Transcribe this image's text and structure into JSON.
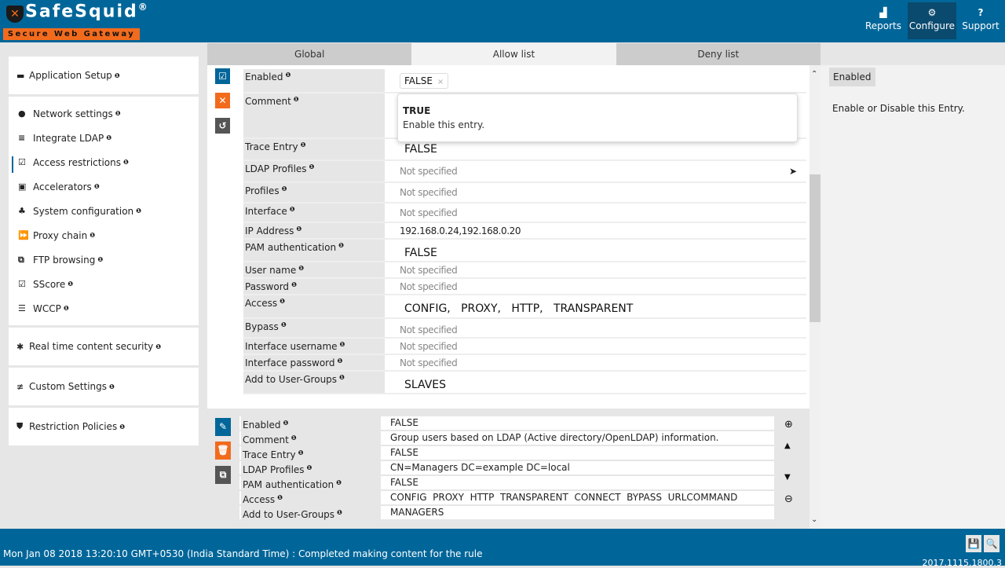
{
  "brand": {
    "name": "SafeSquid",
    "reg": "®",
    "tagline": "Secure Web Gateway"
  },
  "nav": [
    {
      "label": "Reports",
      "icon": "chart-icon"
    },
    {
      "label": "Configure",
      "icon": "cogs-icon",
      "active": true
    },
    {
      "label": "Support",
      "icon": "question-icon"
    }
  ],
  "sidebar": {
    "app_setup": "Application Setup",
    "items": [
      "Network settings",
      "Integrate LDAP",
      "Access restrictions",
      "Accelerators",
      "System configuration",
      "Proxy chain",
      "FTP browsing",
      "SScore",
      "WCCP"
    ],
    "realtime": "Real time content security",
    "custom": "Custom Settings",
    "restriction": "Restriction Policies",
    "info_glyph": "❶"
  },
  "tabs": [
    "Global",
    "Allow list",
    "Deny list"
  ],
  "active_tab": "Allow list",
  "editor": {
    "fields": [
      {
        "label": "Enabled",
        "value": "FALSE"
      },
      {
        "label": "Comment",
        "value": ""
      },
      {
        "label": "Trace Entry",
        "value": "FALSE"
      },
      {
        "label": "LDAP Profiles",
        "value": "Not specified"
      },
      {
        "label": "Profiles",
        "value": "Not specified"
      },
      {
        "label": "Interface",
        "value": "Not specified"
      },
      {
        "label": "IP Address",
        "value": "192.168.0.24,192.168.0.20"
      },
      {
        "label": "PAM authentication",
        "value": "FALSE"
      },
      {
        "label": "User name",
        "value": "Not specified"
      },
      {
        "label": "Password",
        "value": "Not specified"
      },
      {
        "label": "Access",
        "value": "CONFIG,   PROXY,   HTTP,   TRANSPARENT"
      },
      {
        "label": "Bypass",
        "value": "Not specified"
      },
      {
        "label": "Interface username",
        "value": "Not specified"
      },
      {
        "label": "Interface password",
        "value": "Not specified"
      },
      {
        "label": "Add to User-Groups",
        "value": "SLAVES"
      }
    ],
    "dropdown": {
      "option": "TRUE",
      "description": "Enable this entry."
    },
    "tag_remove": "×"
  },
  "entry": {
    "fields": [
      {
        "label": "Enabled",
        "value": "FALSE"
      },
      {
        "label": "Comment",
        "value": "Group users based on LDAP (Active directory/OpenLDAP) information."
      },
      {
        "label": "Trace Entry",
        "value": "FALSE"
      },
      {
        "label": "LDAP Profiles",
        "value": "CN=Managers DC=example DC=local"
      },
      {
        "label": "PAM authentication",
        "value": "FALSE"
      },
      {
        "label": "Access",
        "value": "CONFIG  PROXY  HTTP  TRANSPARENT  CONNECT  BYPASS  URLCOMMAND"
      },
      {
        "label": "Add to User-Groups",
        "value": "MANAGERS"
      }
    ]
  },
  "help": {
    "title": "Enabled",
    "description": "Enable or Disable this Entry."
  },
  "footer": {
    "message": "Mon Jan 08 2018 13:20:10 GMT+0530 (India Standard Time) : Completed making content for the rule",
    "version": "2017.1115.1800.3"
  },
  "colors": {
    "primary": "#006699",
    "accent": "#f26b1d",
    "dark_button": "#555555"
  }
}
